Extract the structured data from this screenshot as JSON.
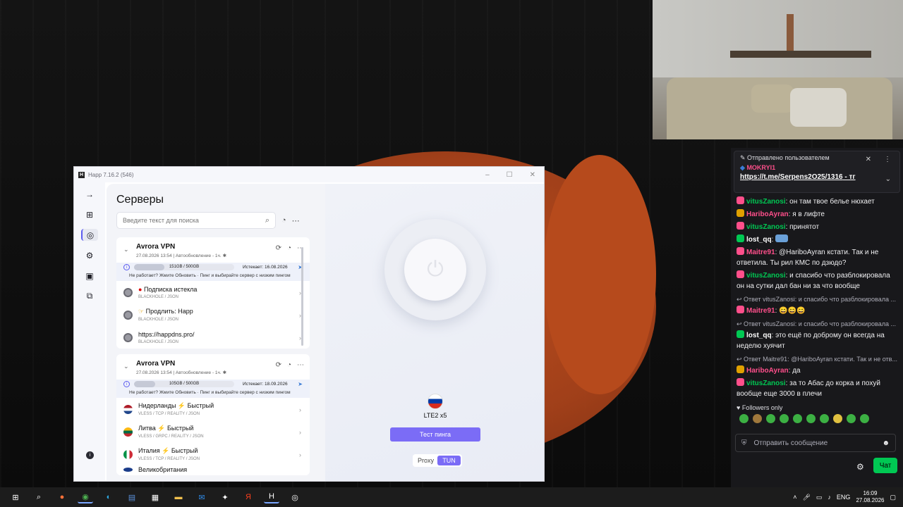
{
  "app": {
    "title": "Happ 7.16.2 (546)",
    "page_title": "Серверы",
    "search_placeholder": "Введите текст для поиска",
    "groups": [
      {
        "name": "Avrora VPN",
        "subtitle": "27.08.2026 13:54 | Автообновление - 1ч.",
        "usage": "151GB / 500GB",
        "usage_fraction": 0.302,
        "expires": "Истекает: 16.08.2026",
        "hint": "Не работает? Жмите Обновить · Пинг и выбирайте сервер с низким пингом",
        "servers": [
          {
            "name": "Подписка истекла",
            "proto": "BLACKHOLE / JSON",
            "icon": "red-circle"
          },
          {
            "name": "Продлить: Happ",
            "proto": "BLACKHOLE / JSON",
            "icon": "hand"
          },
          {
            "name": "https://happdns.pro/",
            "proto": "BLACKHOLE / JSON",
            "icon": "globe"
          }
        ]
      },
      {
        "name": "Avrora VPN",
        "subtitle": "27.08.2026 13:54 | Автообновление - 1ч.",
        "usage": "105GB / 500GB",
        "usage_fraction": 0.21,
        "expires": "Истекает: 18.09.2026",
        "hint": "Не работает? Жмите Обновить · Пинг и выбирайте сервер с низким пингом",
        "servers": [
          {
            "name": "Нидерланды ⚡ Быстрый",
            "proto": "VLESS / TCP / REALITY / JSON",
            "icon": "nl-flag"
          },
          {
            "name": "Литва ⚡ Быстрый",
            "proto": "VLESS / GRPC / REALITY / JSON",
            "icon": "lt-flag"
          },
          {
            "name": "Италия ⚡ Быстрый",
            "proto": "VLESS / TCP / REALITY / JSON",
            "icon": "it-flag"
          }
        ],
        "partial": "Великобритания"
      }
    ],
    "current_server": "LTE2 x5",
    "ping_button": "Тест пинга",
    "mode_proxy": "Proxy",
    "mode_tun": "TUN"
  },
  "chat": {
    "pinned_label": "Отправлено пользователем",
    "pinned_user": "MOKRYI1",
    "pinned_link": "https://t.me/Serpens2O25/1316",
    "pinned_suffix": " - тг",
    "messages": [
      {
        "user": "vitusZanosi",
        "color": "#00c853",
        "text": ": он там твое белье нюхает"
      },
      {
        "user": "HariboAyran",
        "color": "#ff4f8b",
        "text": ": я в лифте"
      },
      {
        "user": "vitusZanosi",
        "color": "#00c853",
        "text": ": принятот"
      },
      {
        "user": "lost_qq",
        "color": "#ffffff",
        "text": ":"
      },
      {
        "user": "Maitre91",
        "color": "#ff4f8b",
        "text": ": @HariboAyran кстати. Так и не ответила. Ты рил КМС по дзюдо?"
      },
      {
        "user": "vitusZanosi",
        "color": "#00c853",
        "text": ": и спасибо что разблокировала он на сутки дал бан ни за что вообще"
      }
    ],
    "reply1": "↩ Ответ vitusZanosi: и спасибо что разблокировала ...",
    "msg_maitre2_user": "Maitre91",
    "msg_maitre2_text": ": 😄😄😄",
    "reply2": "↩ Ответ vitusZanosi: и спасибо что разблокировала ...",
    "msg_lost_user": "lost_qq",
    "msg_lost_text": ": это ещё по доброму он всегда на неделю хуячит",
    "reply3": "↩ Ответ Maitre91: @HariboAyran кстати. Так и не отв...",
    "msg_haribo_user": "HariboAyran",
    "msg_haribo_text": ": да",
    "msg_vitus_user": "vitusZanosi",
    "msg_vitus_text": ": за то Абас до корка и похуй вообще еще 3000 в плечи",
    "followers_only": "♥ Followers only",
    "input_placeholder": "Отправить сообщение",
    "send_label": "Чат"
  },
  "taskbar": {
    "lang": "ENG",
    "time": "16:09",
    "date": "27.08.2026"
  }
}
